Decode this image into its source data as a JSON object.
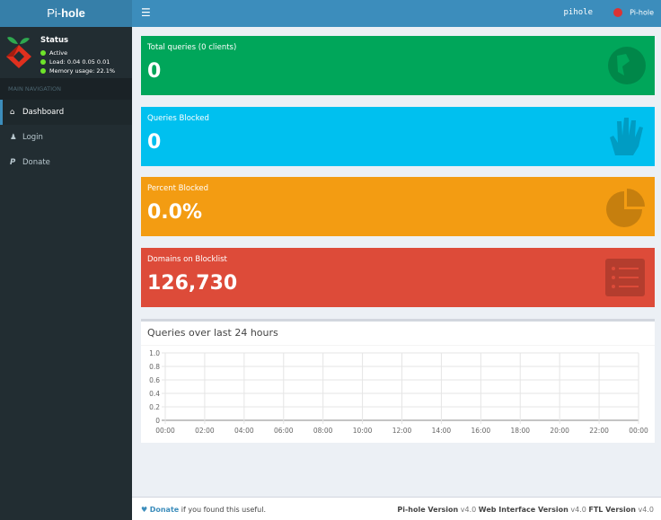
{
  "header": {
    "logo_prefix": "Pi-",
    "logo_bold": "hole",
    "hostname": "pihole",
    "user": "Pi-hole",
    "menu_icon": "hamburger-icon"
  },
  "sidebar": {
    "status_title": "Status",
    "status_active": "Active",
    "load": "Load:  0.04  0.05  0.01",
    "memory": "Memory usage:  22.1%",
    "nav_header": "MAIN NAVIGATION",
    "items": [
      {
        "label": "Dashboard",
        "icon": "home-icon"
      },
      {
        "label": "Login",
        "icon": "user-icon"
      },
      {
        "label": "Donate",
        "icon": "paypal-icon"
      }
    ]
  },
  "stats": [
    {
      "title": "Total queries (0 clients)",
      "value": "0",
      "color": "#00a65a",
      "icon": "globe-icon"
    },
    {
      "title": "Queries Blocked",
      "value": "0",
      "color": "#00c0ef",
      "icon": "hand-icon"
    },
    {
      "title": "Percent Blocked",
      "value": "0.0%",
      "color": "#f39c12",
      "icon": "pie-chart-icon"
    },
    {
      "title": "Domains on Blocklist",
      "value": "126,730",
      "color": "#dd4b39",
      "icon": "list-icon"
    }
  ],
  "chart_data": {
    "type": "line",
    "title": "Queries over last 24 hours",
    "x": [
      "00:00",
      "02:00",
      "04:00",
      "06:00",
      "08:00",
      "10:00",
      "12:00",
      "14:00",
      "16:00",
      "18:00",
      "20:00",
      "22:00",
      "00:00"
    ],
    "yticks": [
      "0",
      "0.2",
      "0.4",
      "0.6",
      "0.8",
      "1.0"
    ],
    "ylim": [
      0,
      1
    ],
    "grid": true,
    "series": []
  },
  "footer": {
    "donate": "Donate",
    "donate_rest": " if you found this useful.",
    "pihole_label": "Pi-hole Version",
    "pihole_ver": "v4.0",
    "web_label": "Web Interface Version",
    "web_ver": "v4.0",
    "ftl_label": "FTL Version",
    "ftl_ver": "v4.0"
  }
}
